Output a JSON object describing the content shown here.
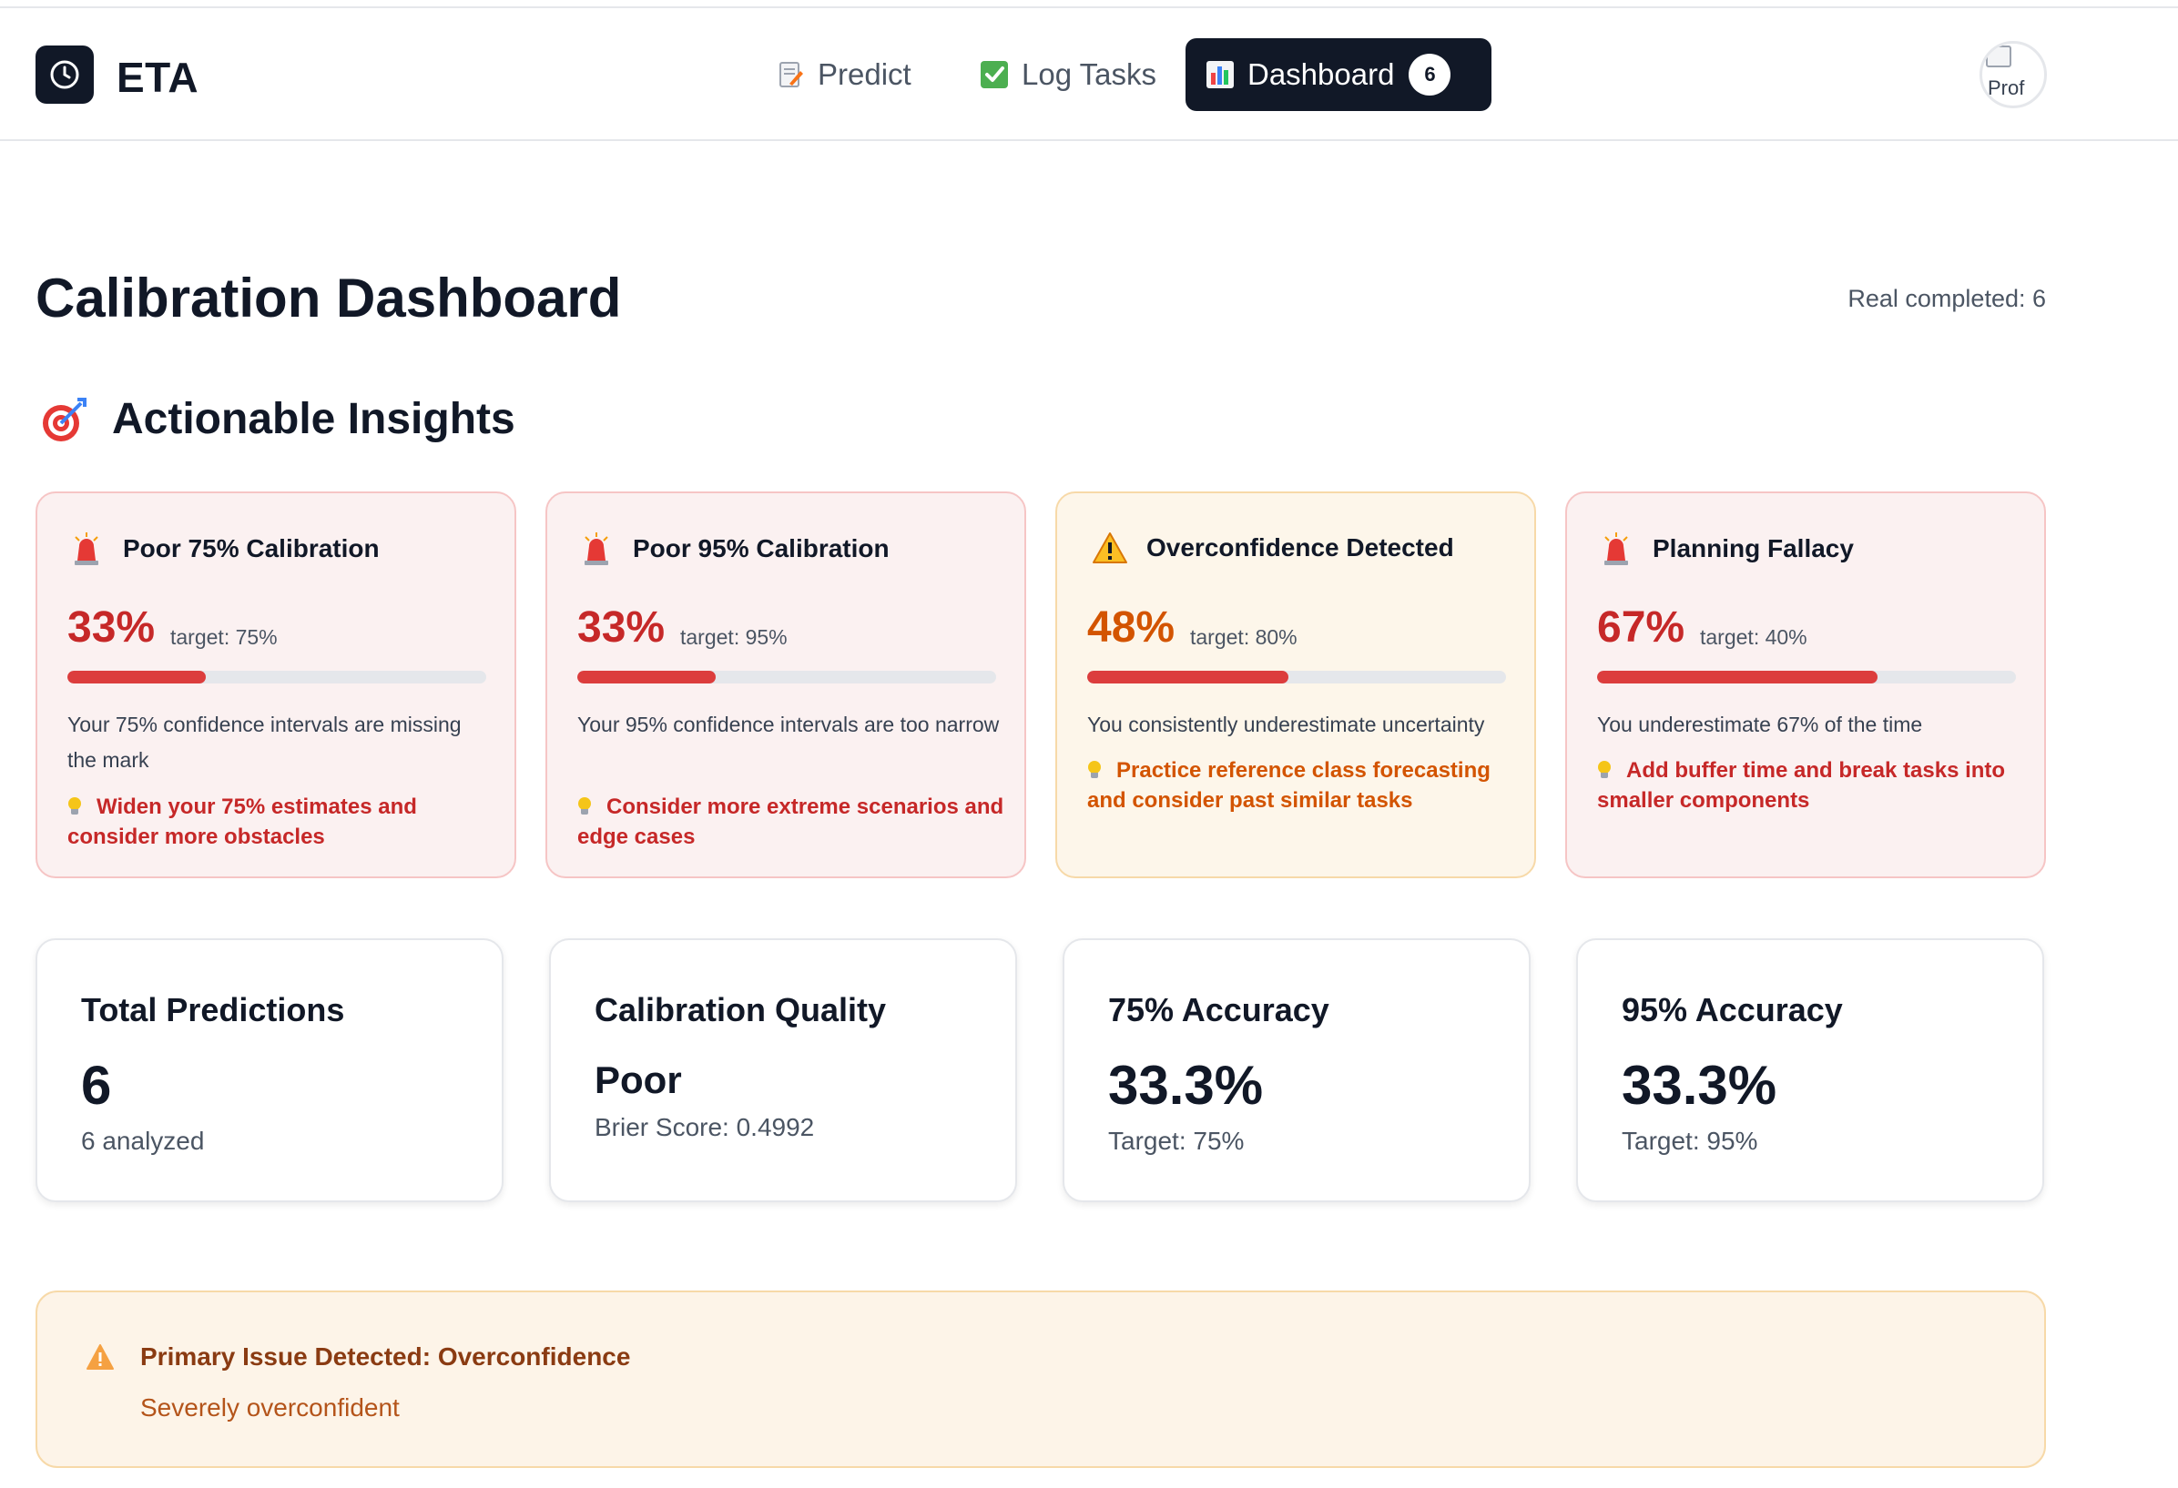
{
  "app": {
    "name": "ETA"
  },
  "nav": {
    "predict": "Predict",
    "log_tasks": "Log Tasks",
    "dashboard": "Dashboard",
    "dashboard_count": "6"
  },
  "profile": {
    "alt": "Prof"
  },
  "page": {
    "title": "Calibration Dashboard",
    "real_completed": "Real completed: 6"
  },
  "insights": {
    "title": "Actionable Insights",
    "cards": [
      {
        "title": "Poor 75% Calibration",
        "value": "33%",
        "target": "target: 75%",
        "level": 0.33,
        "description": "Your 75% confidence intervals are missing the mark",
        "tip": "Widen your 75% estimates and consider more obstacles",
        "icon": "siren-icon"
      },
      {
        "title": "Poor 95% Calibration",
        "value": "33%",
        "target": "target: 95%",
        "level": 0.33,
        "description": "Your 95% confidence intervals are too narrow",
        "tip": "Consider more extreme scenarios and edge cases",
        "icon": "siren-icon"
      },
      {
        "title": "Overconfidence Detected",
        "value": "48%",
        "target": "target: 80%",
        "level": 0.48,
        "description": "You consistently underestimate uncertainty",
        "tip": "Practice reference class forecasting and consider past similar tasks",
        "icon": "warning-icon"
      },
      {
        "title": "Planning Fallacy",
        "value": "67%",
        "target": "target: 40%",
        "level": 0.67,
        "description": "You underestimate 67% of the time",
        "tip": "Add buffer time and break tasks into smaller components",
        "icon": "siren-icon"
      }
    ]
  },
  "stats": [
    {
      "label": "Total Predictions",
      "value": "6",
      "sub": "6 analyzed"
    },
    {
      "label": "Calibration Quality",
      "value": "Poor",
      "sub": "Brier Score: 0.4992"
    },
    {
      "label": "75% Accuracy",
      "value": "33.3%",
      "sub": "Target: 75%"
    },
    {
      "label": "95% Accuracy",
      "value": "33.3%",
      "sub": "Target: 95%"
    }
  ],
  "issue": {
    "title": "Primary Issue Detected: Overconfidence",
    "description": "Severely overconfident"
  },
  "colors": {
    "primary_dark": "#111827",
    "danger": "#c62828",
    "warning": "#d35400",
    "bar_fill": "#dc3d3d"
  }
}
